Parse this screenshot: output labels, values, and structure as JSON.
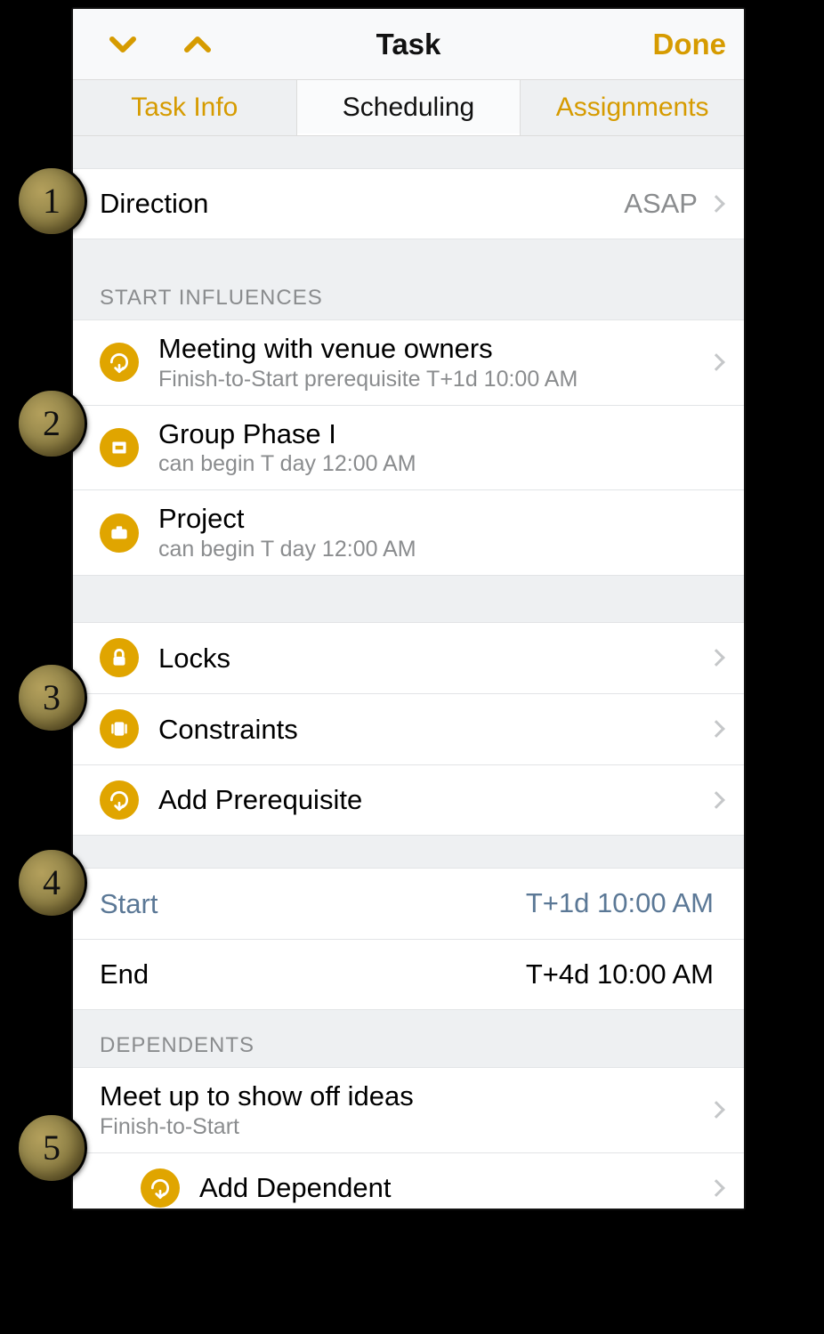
{
  "header": {
    "title": "Task",
    "done_label": "Done"
  },
  "tabs": {
    "task_info": "Task Info",
    "scheduling": "Scheduling",
    "assignments": "Assignments"
  },
  "direction": {
    "label": "Direction",
    "value": "ASAP"
  },
  "start_influences": {
    "header": "START INFLUENCES",
    "items": [
      {
        "title": "Meeting with venue owners",
        "subtitle": "Finish-to-Start prerequisite T+1d 10:00 AM",
        "icon": "prerequisite"
      },
      {
        "title": "Group Phase I",
        "subtitle": "can begin T day 12:00 AM",
        "icon": "group"
      },
      {
        "title": "Project",
        "subtitle": "can begin T day 12:00 AM",
        "icon": "project"
      }
    ]
  },
  "control_rows": {
    "locks": "Locks",
    "constraints": "Constraints",
    "add_prerequisite": "Add Prerequisite"
  },
  "dates": {
    "start_label": "Start",
    "start_value": "T+1d 10:00 AM",
    "end_label": "End",
    "end_value": "T+4d 10:00 AM"
  },
  "dependents": {
    "header": "DEPENDENTS",
    "item": {
      "title": "Meet up to show off ideas",
      "subtitle": "Finish-to-Start"
    },
    "add_dependent": "Add Dependent"
  },
  "callouts": [
    "1",
    "2",
    "3",
    "4",
    "5"
  ],
  "colors": {
    "accent": "#d69b00",
    "iconfill": "#e0a500"
  }
}
